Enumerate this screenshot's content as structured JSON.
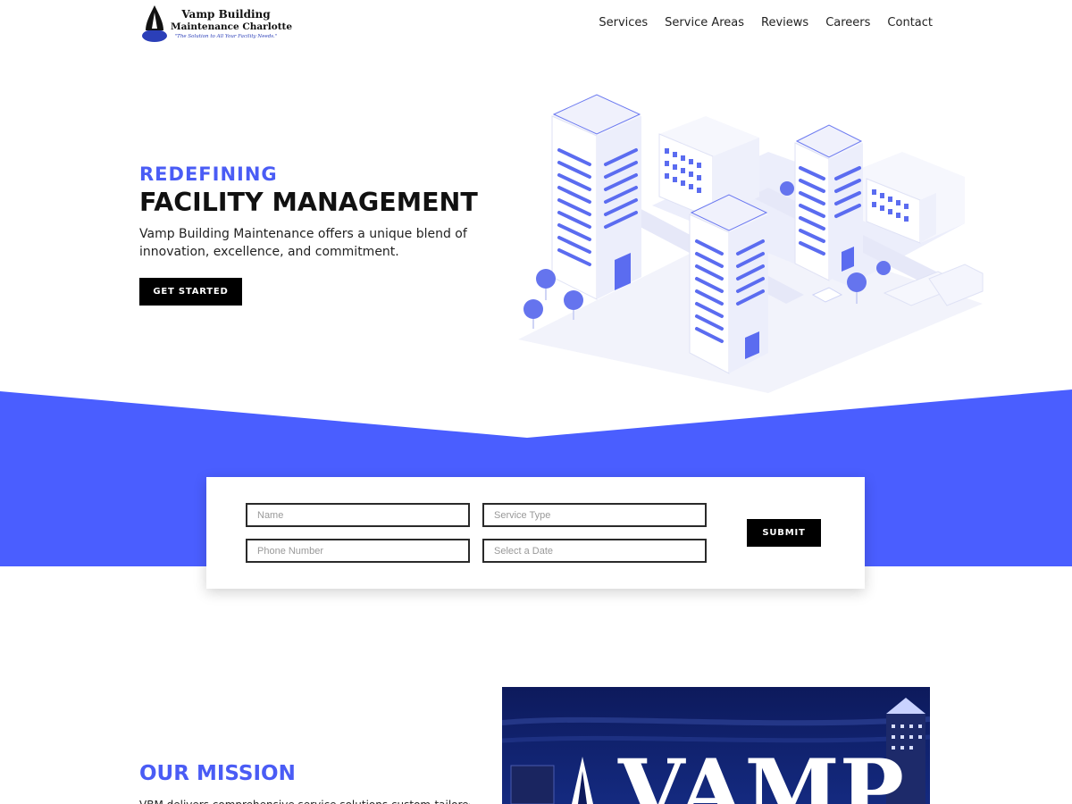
{
  "header": {
    "logo": {
      "line1": "Vamp Building",
      "line2": "Maintenance Charlotte",
      "tagline": "\"The Solution to All Your Facility Needs.\""
    },
    "nav": [
      "Services",
      "Service Areas",
      "Reviews",
      "Careers",
      "Contact"
    ]
  },
  "hero": {
    "kicker": "REDEFINING",
    "title": "FACILITY MANAGEMENT",
    "text": "Vamp Building Maintenance offers a unique blend of innovation, excellence, and commitment.",
    "cta": "GET STARTED"
  },
  "form": {
    "name_placeholder": "Name",
    "service_placeholder": "Service Type",
    "phone_placeholder": "Phone Number",
    "date_placeholder": "Select a Date",
    "submit": "SUBMIT"
  },
  "mission": {
    "title": "OUR MISSION",
    "text": "VBM delivers comprehensive service solutions custom-tailored",
    "image_text": "VAMP"
  },
  "colors": {
    "accent": "#4a5cf5",
    "band": "#4a5eff",
    "button": "#000000"
  }
}
